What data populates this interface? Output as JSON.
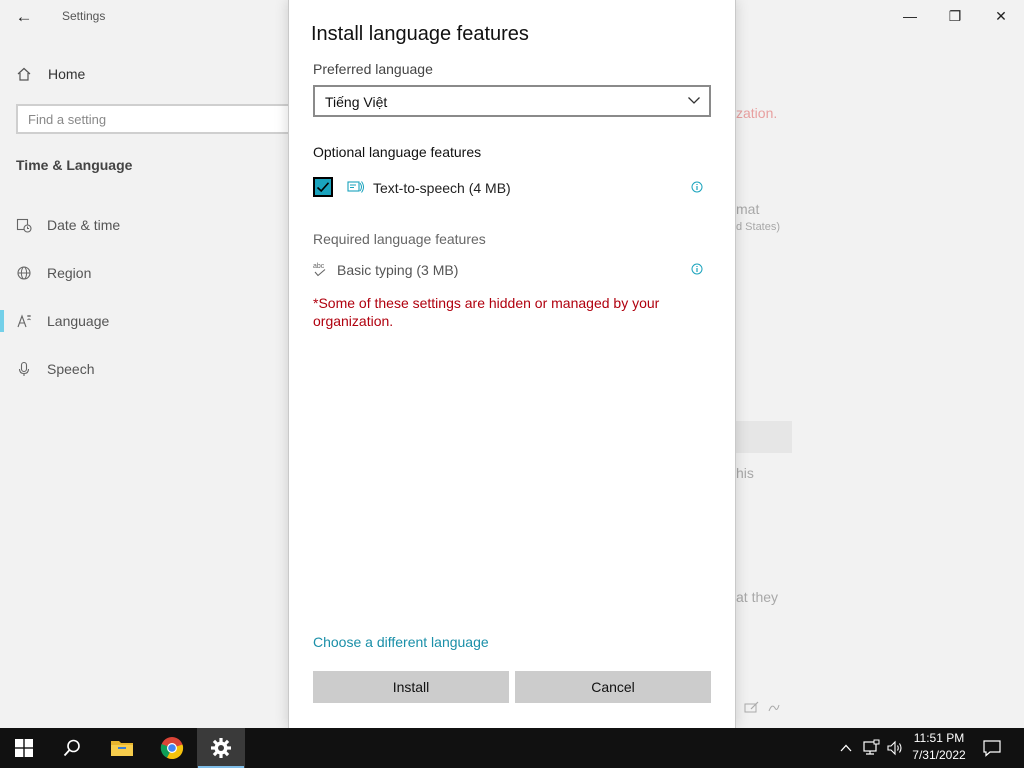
{
  "settings_window": {
    "title": "Settings",
    "back_label": "←",
    "home_label": "Home",
    "search_placeholder": "Find a setting",
    "section_title": "Time & Language",
    "nav_items": [
      {
        "label": "Date & time",
        "icon": "calendar-clock-icon"
      },
      {
        "label": "Region",
        "icon": "globe-icon"
      },
      {
        "label": "Language",
        "icon": "language-icon",
        "active": true
      },
      {
        "label": "Speech",
        "icon": "microphone-icon"
      }
    ],
    "controls": {
      "minimize": "—",
      "restore": "❐",
      "close": "✕"
    },
    "background_fragments": {
      "red_text": "zation.",
      "format_text": "mat",
      "format_sub": "d States)",
      "his_text": "his",
      "at_they_text": "at they"
    }
  },
  "dialog": {
    "title": "Install language features",
    "preferred_label": "Preferred language",
    "preferred_value": "Tiếng Việt",
    "optional_title": "Optional language features",
    "optional_features": [
      {
        "label": "Text-to-speech (4 MB)",
        "checked": true
      }
    ],
    "required_title": "Required language features",
    "required_features": [
      {
        "label": "Basic typing (3 MB)"
      }
    ],
    "managed_message": "*Some of these settings are hidden or managed by your organization.",
    "different_language_link": "Choose a different language",
    "install_button": "Install",
    "cancel_button": "Cancel"
  },
  "taskbar": {
    "pinned": [
      "start-button",
      "search-icon",
      "file-explorer-icon",
      "chrome-icon",
      "settings-icon"
    ],
    "time": "11:51 PM",
    "date": "7/31/2022"
  },
  "colors": {
    "accent": "#1aa3bd",
    "link": "#1a8fa8",
    "error": "#b0000e",
    "taskbar": "#111111"
  }
}
